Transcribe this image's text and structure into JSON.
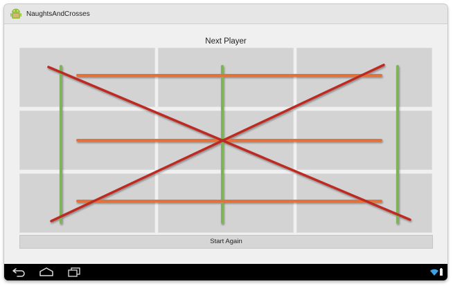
{
  "app": {
    "title": "NaughtsAndCrosses",
    "icon": "android-robot-icon"
  },
  "game": {
    "status": "Next Player",
    "board": [
      [
        "",
        "",
        ""
      ],
      [
        "",
        "",
        ""
      ],
      [
        "",
        "",
        ""
      ]
    ],
    "lines_colors": {
      "vertical": "#7fb35a",
      "horizontal": "#e0733a",
      "diagonal": "#bd2b22"
    },
    "start_again_label": "Start Again"
  },
  "navigation": {
    "back": "back-icon",
    "home": "home-icon",
    "recents": "recent-apps-icon",
    "status": [
      "wifi-icon",
      "battery-icon"
    ]
  },
  "colors": {
    "cell": "#d3d3d3",
    "background": "#f0f0f0",
    "nav_bar": "#000000"
  }
}
